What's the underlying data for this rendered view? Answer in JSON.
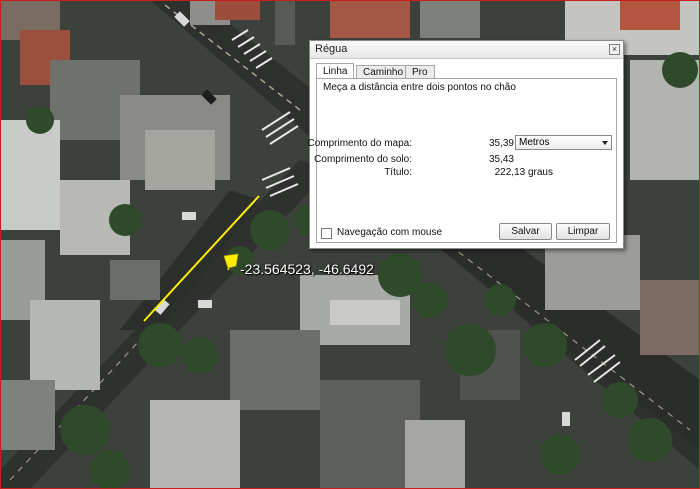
{
  "map": {
    "coordinates_label": "-23.564523, -46.6492",
    "measure_line_color": "#ffee00",
    "frame_color": "#c81e1e"
  },
  "dialog": {
    "title": "Régua",
    "close_icon": "close-icon",
    "tabs": [
      {
        "label": "Linha",
        "active": true
      },
      {
        "label": "Caminho",
        "active": false
      },
      {
        "label": "Pro",
        "active": false
      }
    ],
    "description": "Meça a distância entre dois pontos no chão",
    "map_length_label": "Comprimento do mapa:",
    "map_length_value": "35,39",
    "unit_selected": "Metros",
    "ground_length_label": "Comprimento do solo:",
    "ground_length_value": "35,43",
    "heading_label": "Título:",
    "heading_value": "222,13 graus",
    "mouse_nav_label": "Navegação com mouse",
    "mouse_nav_checked": false,
    "save_label": "Salvar",
    "clear_label": "Limpar"
  }
}
